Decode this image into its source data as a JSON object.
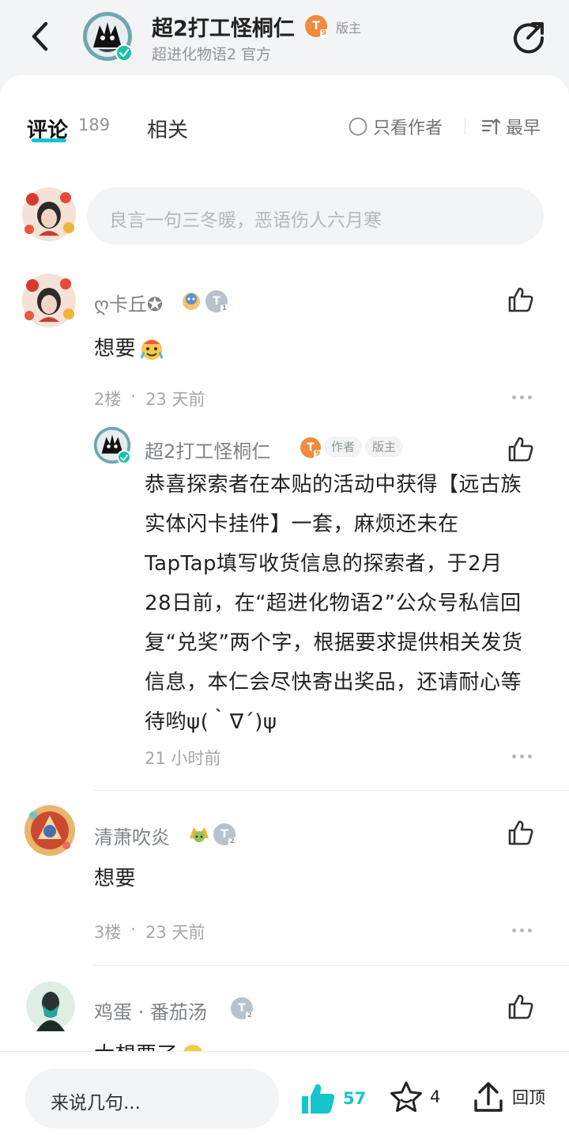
{
  "header": {
    "title": "超2打工怪桐仁",
    "level_badge": "T",
    "level_num": "9",
    "role_label": "版主",
    "subtitle": "超进化物语2 官方"
  },
  "tabs": {
    "comments_label": "评论",
    "comments_count": "189",
    "related_label": "相关",
    "author_only_label": "只看作者",
    "sort_label": "最早"
  },
  "compose": {
    "placeholder": "良言一句三冬暖，恶语伤人六月寒"
  },
  "comments": [
    {
      "username": "ღ卡丘✪",
      "level": "1",
      "text": "想要",
      "floor": "2楼",
      "time": "23 天前",
      "reply": {
        "username": "超2打工怪桐仁",
        "level": "9",
        "tag_author": "作者",
        "tag_mod": "版主",
        "text_lines": [
          "恭喜探索者在本贴的活动中获得【远古族",
          "实体闪卡挂件】一套，麻烦还未在",
          "TapTap填写收货信息的探索者，于2月",
          "28日前，在“超进化物语2”公众号私信回",
          "复“兑奖”两个字，根据要求提供相关发货",
          "信息，本仁会尽快寄出奖品，还请耐心等",
          "待哟ψ(｀∇´)ψ"
        ],
        "time": "21 小时前"
      }
    },
    {
      "username": "清萧吹炎",
      "level": "2",
      "text": "想要",
      "floor": "3楼",
      "time": "23 天前"
    },
    {
      "username": "鸡蛋 · 番茄汤",
      "level": "2",
      "text": "太想要了"
    }
  ],
  "bottom_bar": {
    "input_placeholder": "来说几句...",
    "like_count": "57",
    "fav_count": "4",
    "top_label": "回顶"
  },
  "colors": {
    "accent": "#15c5ce",
    "badge_orange": "#f08a3c",
    "badge_silver": "#b7c2cc",
    "verified_green": "#19c3a5"
  }
}
